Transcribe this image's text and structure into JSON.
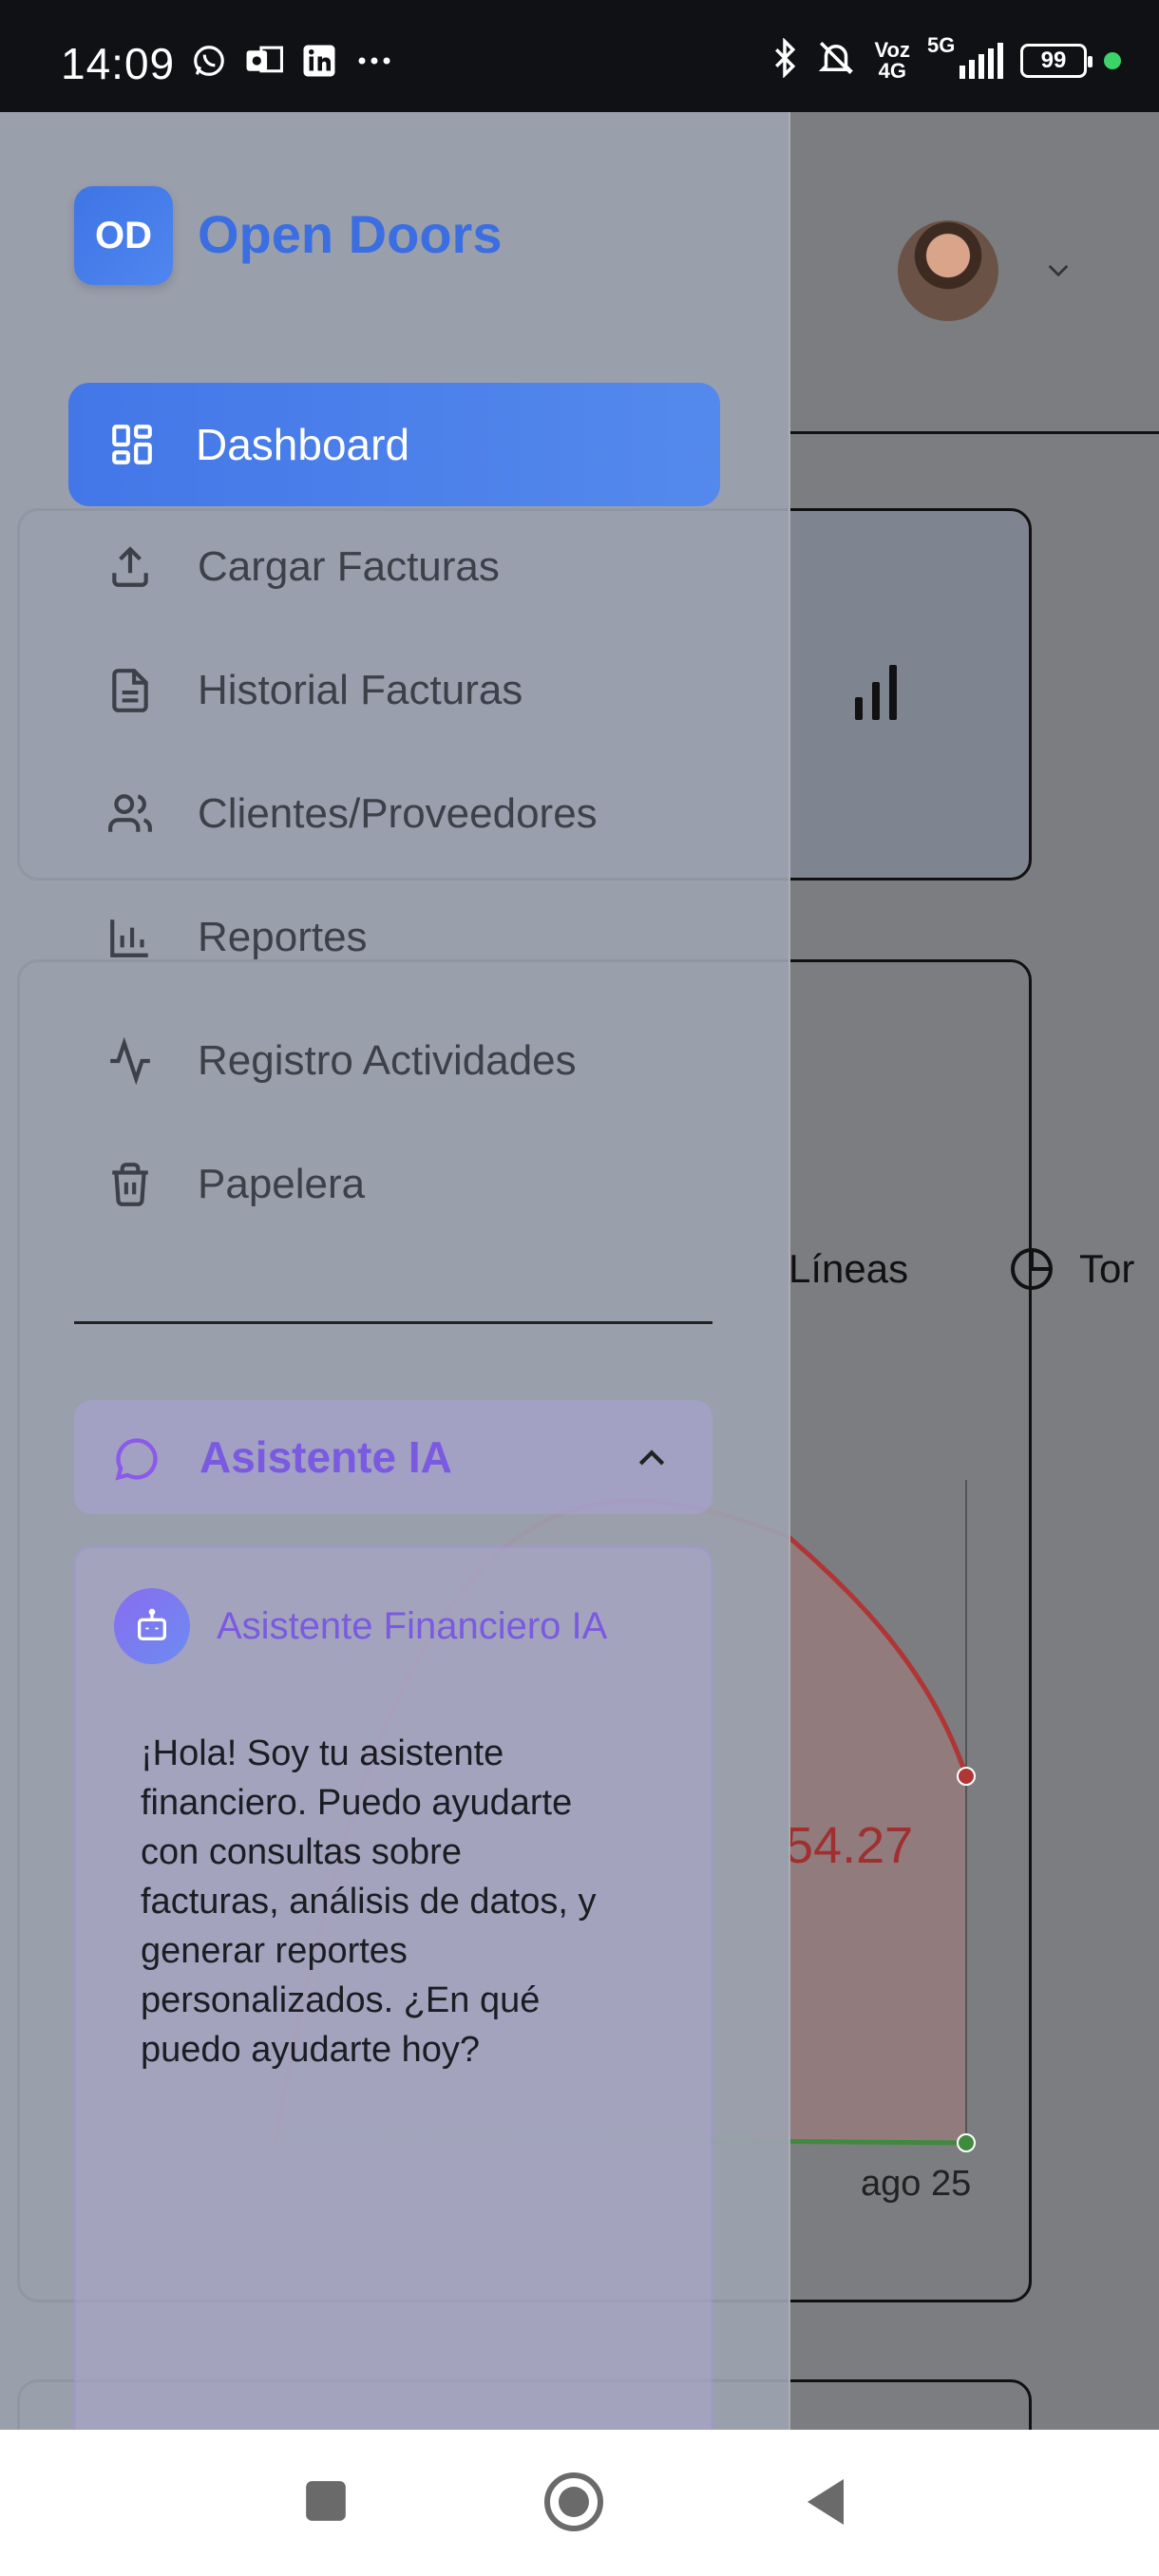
{
  "status_bar": {
    "time": "14:09",
    "left_icons": [
      "whatsapp-icon",
      "outlook-icon",
      "linkedin-icon",
      "more-icon"
    ],
    "network_label_top": "Voz",
    "network_label_bottom": "4G",
    "five_g": "5G",
    "battery": "99"
  },
  "drawer": {
    "logo_initials": "OD",
    "brand": "Open Doors",
    "nav_items": [
      {
        "label": "Dashboard",
        "icon": "grid-icon",
        "active": true
      },
      {
        "label": "Cargar Facturas",
        "icon": "upload-icon"
      },
      {
        "label": "Historial Facturas",
        "icon": "file-icon"
      },
      {
        "label": "Clientes/Proveedores",
        "icon": "users-icon"
      },
      {
        "label": "Reportes",
        "icon": "bar-chart-icon"
      },
      {
        "label": "Registro Actividades",
        "icon": "activity-icon"
      },
      {
        "label": "Papelera",
        "icon": "trash-icon"
      }
    ],
    "assistant": {
      "section_label": "Asistente IA",
      "panel_title": "Asistente Financiero IA",
      "message": "¡Hola! Soy tu asistente financiero. Puedo ayudarte con consultas sobre facturas, análisis de datos, y generar reportes personalizados. ¿En qué puedo ayudarte hoy?"
    }
  },
  "background": {
    "tabs": {
      "lineas": "Líneas",
      "torta": "Tor"
    },
    "value_fragment": "54.27",
    "x_tick_last": "ago 25"
  },
  "colors": {
    "accent_blue": "#3b6ee0",
    "assistant_purple": "#7a5ae0",
    "expense_red": "#b03636",
    "income_green": "#3f8a3f"
  }
}
